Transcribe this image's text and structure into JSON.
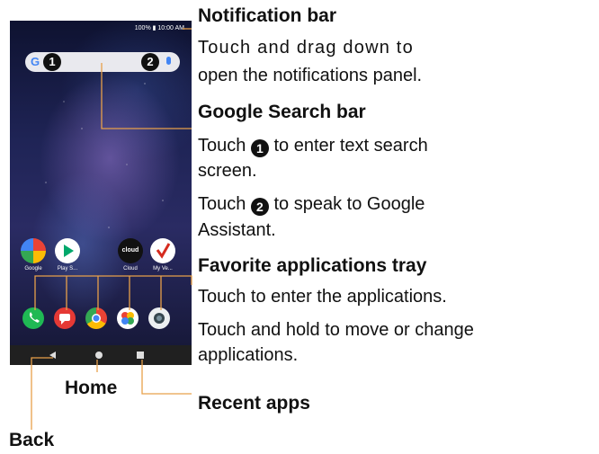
{
  "phone": {
    "status_text": "100% ▮ 10:00 AM",
    "search_g": "G",
    "badge1": "1",
    "badge2": "2",
    "apps": [
      {
        "label": "Google"
      },
      {
        "label": "Play S..."
      },
      {
        "label": "Cloud",
        "icon_text": "cloud"
      },
      {
        "label": "My Ve..."
      }
    ],
    "tray_icons": [
      "phone-icon",
      "messages-icon",
      "chrome-icon",
      "photos-icon",
      "camera-icon"
    ],
    "nav_icons": [
      "back-icon",
      "home-icon",
      "recents-icon"
    ]
  },
  "annotations": {
    "notification_bar": {
      "heading": "Notification bar",
      "line1": "Touch and drag down to",
      "line2": "open the notifications panel."
    },
    "search_bar": {
      "heading": "Google Search bar",
      "touch1_prefix": "Touch",
      "touch1_num": "1",
      "touch1_suffix": "to enter text search",
      "touch1_line2": "screen.",
      "touch2_prefix": "Touch",
      "touch2_num": "2",
      "touch2_suffix": "to speak to Google",
      "touch2_line2": "Assistant."
    },
    "favorites": {
      "heading": "Favorite applications tray",
      "line1": "Touch to enter the applications.",
      "line2": "Touch and hold to move or change",
      "line3": "applications."
    },
    "home": "Home",
    "recent_apps": "Recent apps",
    "back": "Back"
  },
  "colors": {
    "callout_line": "#e8a04a",
    "search_blue": "#4285F4"
  }
}
